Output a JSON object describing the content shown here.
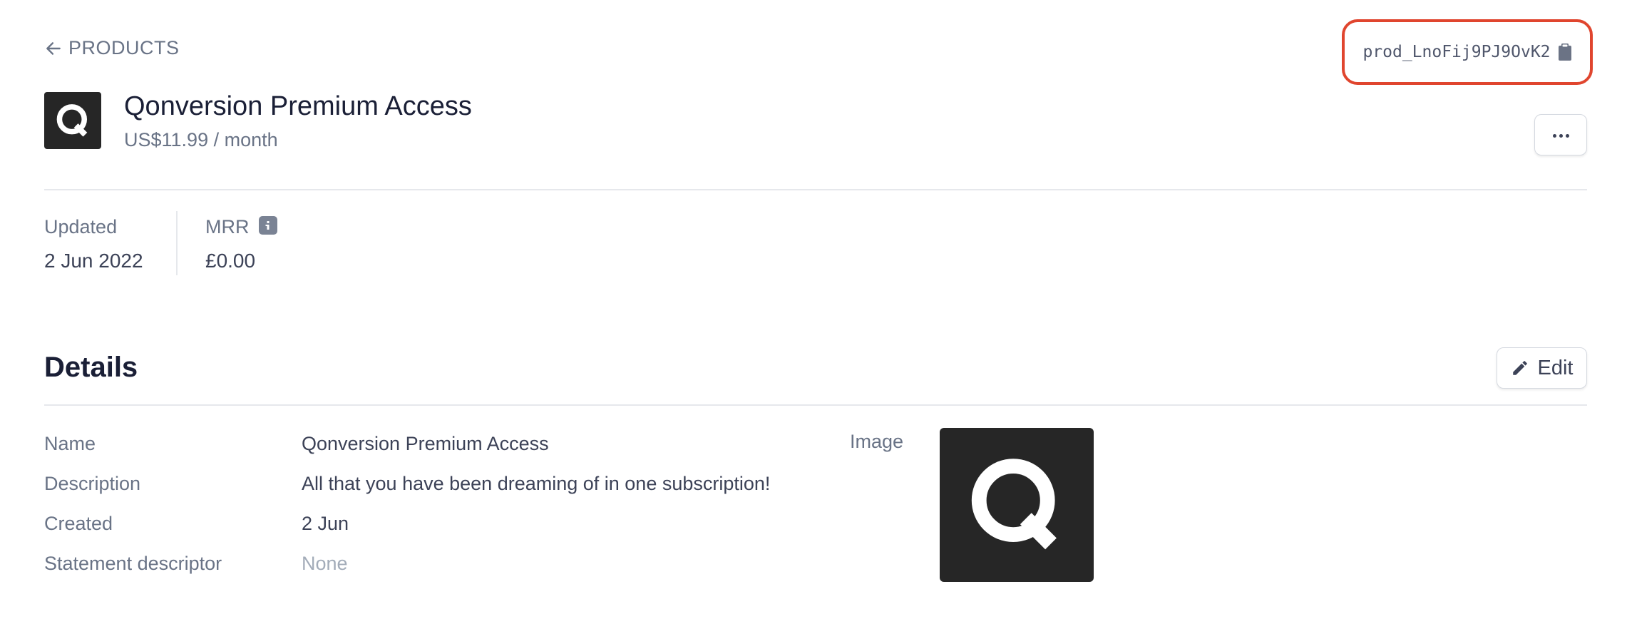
{
  "nav": {
    "back_label": "PRODUCTS"
  },
  "product": {
    "id": "prod_LnoFij9PJ9OvK2",
    "title": "Qonversion Premium Access",
    "price": "US$11.99 / month",
    "logo_letter": "Q"
  },
  "stats": {
    "updated_label": "Updated",
    "updated_value": "2 Jun 2022",
    "mrr_label": "MRR",
    "mrr_value": "£0.00"
  },
  "details": {
    "title": "Details",
    "edit_label": "Edit",
    "rows": [
      {
        "label": "Name",
        "value": "Qonversion Premium Access"
      },
      {
        "label": "Description",
        "value": "All that you have been dreaming of in one subscription!"
      },
      {
        "label": "Created",
        "value": "2 Jun"
      },
      {
        "label": "Statement descriptor",
        "value": "None"
      }
    ],
    "image_label": "Image"
  },
  "colors": {
    "highlight_border": "#e0452e",
    "logo_bg": "#262626",
    "muted_text": "#697386"
  },
  "icons": [
    "arrow-left-icon",
    "clipboard-icon",
    "more-dots-icon",
    "info-icon",
    "pencil-icon"
  ]
}
